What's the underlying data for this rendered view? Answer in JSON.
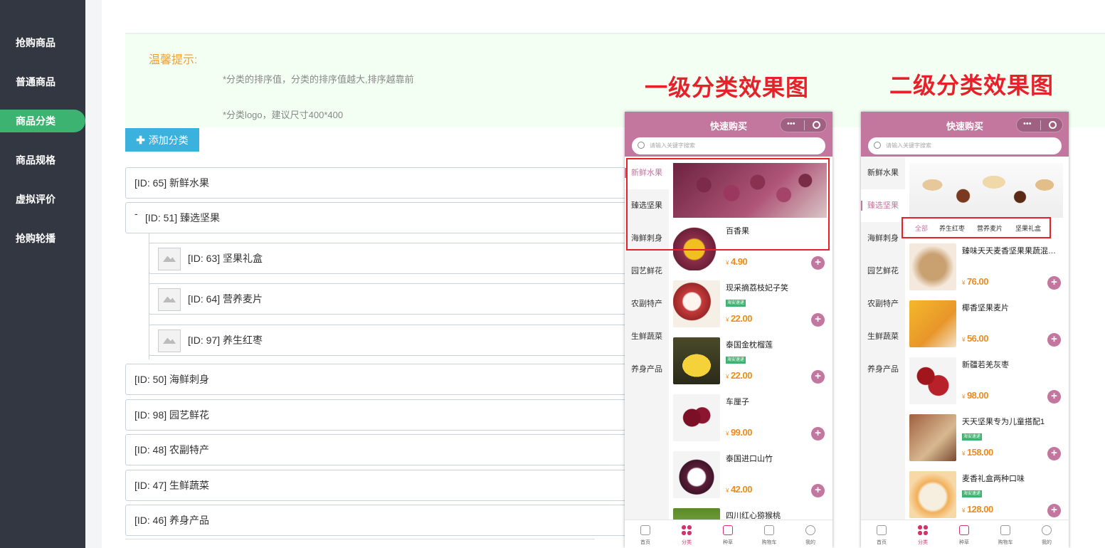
{
  "sidebar": {
    "items": [
      {
        "label": "抢购商品"
      },
      {
        "label": "普通商品"
      },
      {
        "label": "商品分类",
        "active": true
      },
      {
        "label": "商品规格"
      },
      {
        "label": "虚拟评价"
      },
      {
        "label": "抢购轮播"
      }
    ]
  },
  "tips": {
    "title": "温馨提示:",
    "lines": [
      "*分类的排序值，分类的排序值越大,排序越靠前",
      "*分类logo，建议尺寸400*400"
    ]
  },
  "toolbar": {
    "add_label": "添加分类"
  },
  "categories": [
    {
      "label": "[ID: 65] 新鲜水果"
    },
    {
      "label": "[ID: 51] 臻选坚果",
      "toggle": "-"
    },
    {
      "label": "[ID: 63] 坚果礼盒"
    },
    {
      "label": "[ID: 64] 营养麦片"
    },
    {
      "label": "[ID: 97] 养生红枣"
    },
    {
      "label": "[ID: 50] 海鲜刺身"
    },
    {
      "label": "[ID: 98] 园艺鲜花"
    },
    {
      "label": "[ID: 48] 农副特产"
    },
    {
      "label": "[ID: 47] 生鲜蔬菜"
    },
    {
      "label": "[ID: 46] 养身产品"
    }
  ],
  "captions": {
    "first": "一级分类效果图",
    "second": "二级分类效果图"
  },
  "phone": {
    "title": "快速购买",
    "capsule_dots": "•••",
    "search_placeholder": "请输入关键字搜索",
    "categories": [
      "新鲜水果",
      "臻选坚果",
      "海鲜刺身",
      "园艺鲜花",
      "农副特产",
      "生鲜蔬菜",
      "养身产品"
    ],
    "currency": "¥",
    "plus": "+",
    "tabbar": [
      "首页",
      "分类",
      "种草",
      "购物车",
      "我的"
    ],
    "products1": [
      {
        "name": "百香果",
        "price": "4.90"
      },
      {
        "name": "现采摘荔枝妃子笑",
        "price": "22.00",
        "tag": "海安速递"
      },
      {
        "name": "泰国金枕榴莲",
        "price": "22.00",
        "tag": "海安速递"
      },
      {
        "name": "车厘子",
        "price": "99.00"
      },
      {
        "name": "泰国进口山竹",
        "price": "42.00"
      },
      {
        "name": "四川红心猕猴桃"
      }
    ],
    "subtabs": [
      "全部",
      "养生红枣",
      "营养麦片",
      "坚果礼盒"
    ],
    "products2": [
      {
        "name": "臻味天天麦香坚果果蔬混…",
        "price": "76.00"
      },
      {
        "name": "椰香坚果麦片",
        "price": "56.00"
      },
      {
        "name": "新疆若羌灰枣",
        "price": "98.00"
      },
      {
        "name": "天天坚果专为儿童搭配1",
        "price": "158.00",
        "tag": "海安速递"
      },
      {
        "name": "麦香礼盒两种口味",
        "price": "128.00",
        "tag": "海安速递"
      }
    ]
  },
  "colors": {
    "sidebar": "#323742",
    "active": "#3cb371",
    "add_button": "#3ab2dd",
    "phone_theme": "#c3769e",
    "caption": "#e8202a",
    "price": "#f08a1a"
  }
}
